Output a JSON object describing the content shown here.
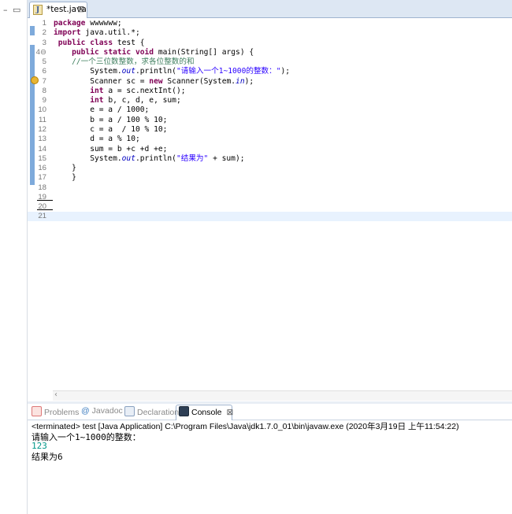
{
  "editor": {
    "tab_label": "*test.java",
    "tab_icon": "java-file-icon",
    "close_glyph": "⊠",
    "file_letter": "J"
  },
  "code_lines": [
    {
      "n": "1",
      "text": "package wwwwww;"
    },
    {
      "n": "2",
      "text": "import java.util.*;"
    },
    {
      "n": "3",
      "text": " public class test {"
    },
    {
      "n": "4⊖",
      "text": "\tpublic static void main(String[] args) {"
    },
    {
      "n": "5",
      "text": "\t//一个三位数整数，求各位整数的和"
    },
    {
      "n": "6",
      "text": "\t\tSystem.out.println(\"请输入一个1~1000的整数：\");"
    },
    {
      "n": "7",
      "text": "\t\tScanner sc = new Scanner(System.in);"
    },
    {
      "n": "8",
      "text": "\t\tint a = sc.nextInt();"
    },
    {
      "n": "9",
      "text": "\t\tint b, c, d, e, sum;"
    },
    {
      "n": "10",
      "text": "\t\te = a / 1000;"
    },
    {
      "n": "11",
      "text": "\t\tb = a / 100 % 10;"
    },
    {
      "n": "12",
      "text": "\t\tc = a  / 10 % 10;"
    },
    {
      "n": "13",
      "text": "\t\td = a % 10;"
    },
    {
      "n": "14",
      "text": "\t\tsum = b +c +d +e;"
    },
    {
      "n": "15",
      "text": "\t\tSystem.out.println(\"结果为\" + sum);"
    },
    {
      "n": "16",
      "text": "\t}"
    },
    {
      "n": "17",
      "text": "\t}"
    },
    {
      "n": "18",
      "text": ""
    },
    {
      "n": "19",
      "text": ""
    },
    {
      "n": "20",
      "text": ""
    },
    {
      "n": "21",
      "text": ""
    }
  ],
  "views": {
    "problems": "Problems",
    "javadoc": "Javadoc",
    "declaration": "Declaration",
    "console": "Console"
  },
  "console": {
    "status": "<terminated> test [Java Application] C:\\Program Files\\Java\\jdk1.7.0_01\\bin\\javaw.exe (2020年3月19日 上午11:54:22)",
    "prompt": "请输入一个1~1000的整数：",
    "input": "123",
    "result": "结果为6"
  },
  "colors": {
    "keyword": "#7f0055",
    "string": "#2a00ff",
    "comment": "#3f7f5f",
    "console_input": "#009688"
  }
}
